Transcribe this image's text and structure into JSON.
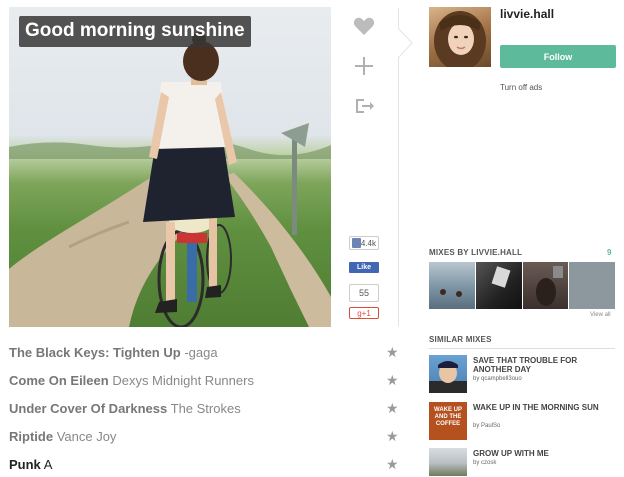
{
  "mix": {
    "title": "Good morning sunshine"
  },
  "social": {
    "fb_like_count": "4.4k",
    "fb_like_label": "Like",
    "gplus_count": "55",
    "gplus_label": "g+1"
  },
  "user": {
    "username": "livvie.hall",
    "follow_label": "Follow",
    "turn_off_ads": "Turn off ads"
  },
  "mixes_by": {
    "heading": "MIXES BY LIVVIE.HALL",
    "count": "9",
    "view_all": "View all"
  },
  "similar": {
    "heading": "SIMILAR MIXES",
    "items": [
      {
        "title": "SAVE THAT TROUBLE FOR ANOTHER DAY",
        "by": "by qcampbell3ouo"
      },
      {
        "title": "WAKE UP IN THE MORNING SUN",
        "by": "by PaulSo",
        "thumb_text": "WAKE UP AND THE COFFEE"
      },
      {
        "title": "GROW UP WITH ME",
        "by": "by czosk"
      }
    ]
  },
  "tracks": [
    {
      "song": "The Black Keys: Tighten Up",
      "artist": "-gaga"
    },
    {
      "song": "Come On Eileen",
      "artist": "Dexys Midnight Runners"
    },
    {
      "song": "Under Cover Of Darkness",
      "artist": "The Strokes"
    },
    {
      "song": "Riptide",
      "artist": "Vance Joy"
    },
    {
      "song": "Punk",
      "artist": "A"
    }
  ],
  "colors": {
    "accent": "#5dbb9c",
    "facebook": "#4267b2",
    "gplus": "#dd4b39"
  }
}
